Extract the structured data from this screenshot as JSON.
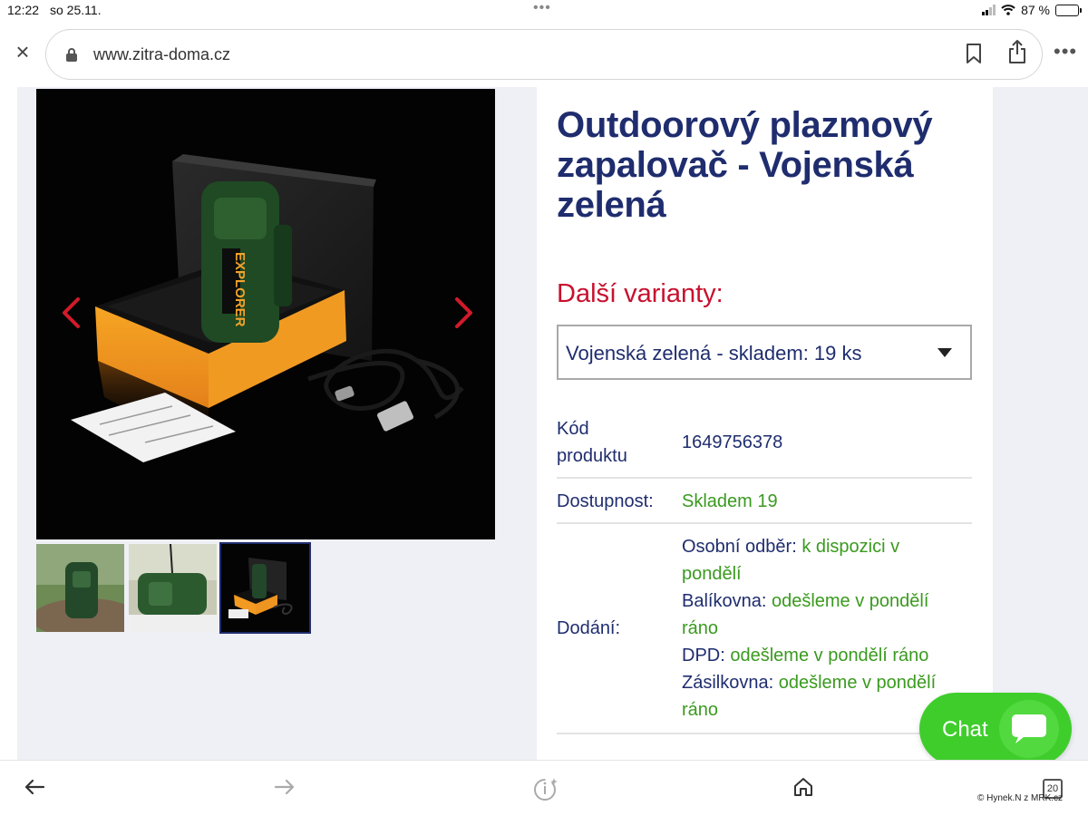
{
  "status_bar": {
    "time": "12:22",
    "date": "so 25.11.",
    "battery_text": "87 %",
    "battery_level": 0.87
  },
  "browser": {
    "url": "www.zitra-doma.cz",
    "icons": [
      "close-icon",
      "lock-icon",
      "bookmark-icon",
      "share-icon",
      "more-icon"
    ]
  },
  "product": {
    "title": "Outdoorový plazmový zapalovač - Vojenská zelená",
    "variants_heading": "Další varianty:",
    "selected_variant": "Vojenská zelená - skladem: 19 ks",
    "gallery": {
      "product_print": "EXPLORER",
      "thumbnails": [
        "thumbnail-1",
        "thumbnail-2",
        "thumbnail-3"
      ],
      "selected_thumbnail_index": 2
    },
    "info": {
      "code_label": "Kód produktu",
      "code_value": "1649756378",
      "availability_label": "Dostupnost:",
      "availability_value": "Skladem 19",
      "delivery_label": "Dodání:",
      "delivery_options": [
        {
          "name": "Osobní odběr:",
          "value": "k dispozici v pondělí"
        },
        {
          "name": "Balíkovna:",
          "value": "odešleme v pondělí ráno"
        },
        {
          "name": "DPD:",
          "value": "odešleme v pondělí ráno"
        },
        {
          "name": "Zásilkovna:",
          "value": "odešleme v pondělí ráno"
        }
      ]
    }
  },
  "chat": {
    "label": "Chat"
  },
  "bottom_bar": {
    "tab_count": "20",
    "watermark": "© Hynek.N z MRK.cz"
  },
  "colors": {
    "title_blue": "#1f2d6e",
    "accent_red": "#c8102e",
    "stock_green": "#3a9a1f",
    "chat_green": "#3fcd2c",
    "page_background": "#eef0f6"
  }
}
